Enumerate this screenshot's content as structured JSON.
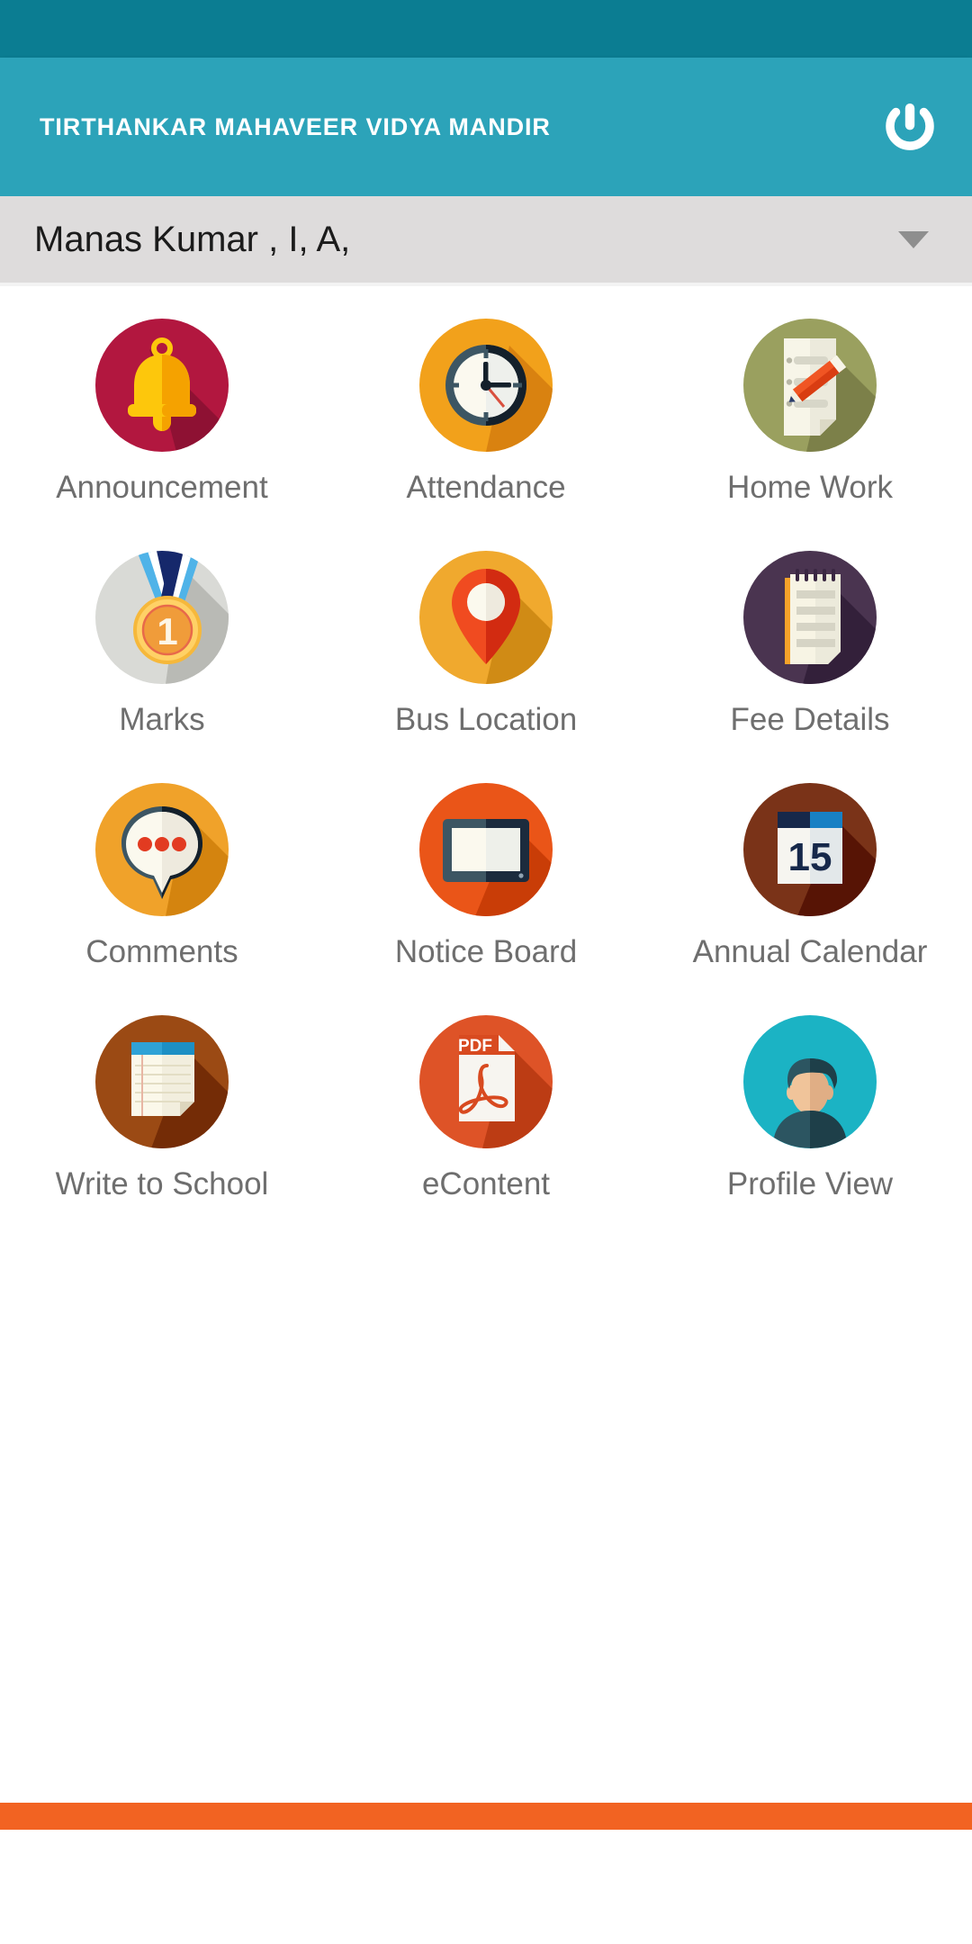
{
  "app": {
    "title": "TIRTHANKAR MAHAVEER VIDYA MANDIR",
    "power_icon": "power-icon",
    "status_bar_color": "#0b7d92",
    "app_bar_color": "#2ca3b9",
    "accent_bottom_color": "#f26322"
  },
  "student_selector": {
    "value": "Manas Kumar , I, A,",
    "caret_icon": "chevron-down-icon",
    "background_color": "#dedcdc"
  },
  "menu": {
    "items": [
      {
        "label": "Announcement",
        "icon": "bell-icon",
        "circle_color": "#b2173f"
      },
      {
        "label": "Attendance",
        "icon": "clock-icon",
        "circle_color": "#f2a11b"
      },
      {
        "label": "Home Work",
        "icon": "document-pencil-icon",
        "circle_color": "#9aa05f"
      },
      {
        "label": "Marks",
        "icon": "medal-icon",
        "circle_color": "#d9dad6"
      },
      {
        "label": "Bus Location",
        "icon": "map-pin-icon",
        "circle_color": "#f0a92e"
      },
      {
        "label": "Fee Details",
        "icon": "notepad-icon",
        "circle_color": "#4a3450"
      },
      {
        "label": "Comments",
        "icon": "speech-bubble-icon",
        "circle_color": "#f0a22a"
      },
      {
        "label": "Notice Board",
        "icon": "board-icon",
        "circle_color": "#ea5518"
      },
      {
        "label": "Annual Calendar",
        "icon": "calendar-icon",
        "circle_color": "#7a3318"
      },
      {
        "label": "Write to School",
        "icon": "note-lined-icon",
        "circle_color": "#9b4a14"
      },
      {
        "label": "eContent",
        "icon": "pdf-file-icon",
        "circle_color": "#de5327"
      },
      {
        "label": "Profile View",
        "icon": "avatar-icon",
        "circle_color": "#1bb3c4"
      }
    ]
  },
  "calendar_day": "15",
  "medal_number": "1",
  "pdf_label": "PDF"
}
